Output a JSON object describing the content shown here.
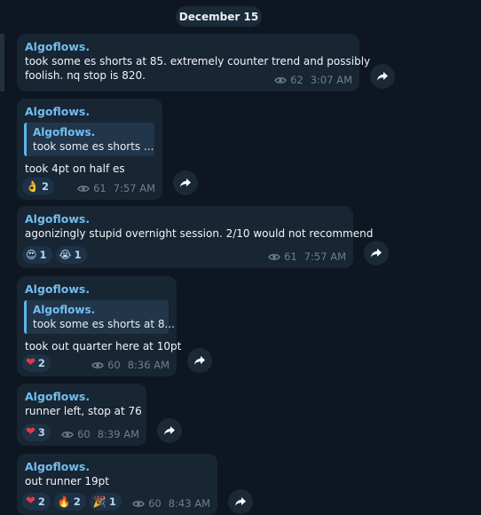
{
  "date_separator": "December 15",
  "messages": [
    {
      "author": "Algoflows.",
      "lines": [
        "took some es shorts at 85. extremely counter trend and possibly",
        "foolish. nq stop is 820."
      ],
      "views": "62",
      "time": "3:07 AM"
    },
    {
      "author": "Algoflows.",
      "reply": {
        "author": "Algoflows.",
        "text": "took some es shorts ..."
      },
      "lines": [
        "took 4pt on half es"
      ],
      "reactions": [
        {
          "emoji": "👌",
          "count": "2"
        }
      ],
      "views": "61",
      "time": "7:57 AM"
    },
    {
      "author": "Algoflows.",
      "lines": [
        "agonizingly stupid overnight session. 2/10 would not recommend"
      ],
      "reactions": [
        {
          "emoji": "😍",
          "count": "1"
        },
        {
          "emoji": "😭",
          "count": "1"
        }
      ],
      "views": "61",
      "time": "7:57 AM"
    },
    {
      "author": "Algoflows.",
      "reply": {
        "author": "Algoflows.",
        "text": "took some es shorts at 8..."
      },
      "lines": [
        "took out quarter here at 10pt"
      ],
      "reactions": [
        {
          "emoji": "❤",
          "count": "2"
        }
      ],
      "views": "60",
      "time": "8:36 AM"
    },
    {
      "author": "Algoflows.",
      "lines": [
        "runner left, stop at 76"
      ],
      "reactions": [
        {
          "emoji": "❤",
          "count": "3"
        }
      ],
      "views": "60",
      "time": "8:39 AM"
    },
    {
      "author": "Algoflows.",
      "lines": [
        "out runner 19pt"
      ],
      "reactions": [
        {
          "emoji": "❤",
          "count": "2"
        },
        {
          "emoji": "🔥",
          "count": "2"
        },
        {
          "emoji": "🎉",
          "count": "1"
        }
      ],
      "views": "60",
      "time": "8:43 AM"
    }
  ],
  "icons": {
    "views": "eye-icon",
    "forward": "forward-arrow-icon"
  },
  "colors": {
    "background": "#0e1621",
    "bubble": "#182533",
    "author": "#71bef1",
    "meta": "#6d7f8f",
    "reaction_bg": "#1e3247"
  }
}
